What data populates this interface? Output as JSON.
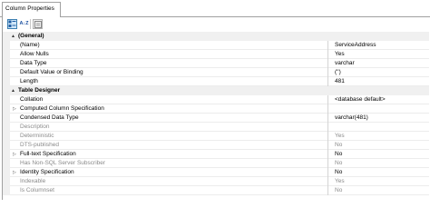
{
  "tab": {
    "label": "Column Properties"
  },
  "toolbar": {
    "categorized_icon": "categorized-icon",
    "alphabetical_icon": "alphabetical-sort-icon",
    "alphabetical_glyph": "A↓Z",
    "property_pages_icon": "property-pages-icon"
  },
  "grid": {
    "general": {
      "label": "(General)",
      "rows": [
        {
          "name": "(Name)",
          "value": "ServiceAddress"
        },
        {
          "name": "Allow Nulls",
          "value": "Yes"
        },
        {
          "name": "Data Type",
          "value": "varchar"
        },
        {
          "name": "Default Value or Binding",
          "value": "('')"
        },
        {
          "name": "Length",
          "value": "481"
        }
      ]
    },
    "designer": {
      "label": "Table Designer",
      "rows": [
        {
          "name": "Collation",
          "value": "<database default>"
        },
        {
          "name": "Computed Column Specification",
          "value": ""
        },
        {
          "name": "Condensed Data Type",
          "value": "varchar(481)"
        },
        {
          "name": "Description",
          "value": ""
        },
        {
          "name": "Deterministic",
          "value": "Yes"
        },
        {
          "name": "DTS-published",
          "value": "No"
        },
        {
          "name": "Full-text Specification",
          "value": "No"
        },
        {
          "name": "Has Non-SQL Server Subscriber",
          "value": "No"
        },
        {
          "name": "Identity Specification",
          "value": "No"
        },
        {
          "name": "Indexable",
          "value": "Yes"
        },
        {
          "name": "Is Columnset",
          "value": "No"
        }
      ]
    }
  }
}
